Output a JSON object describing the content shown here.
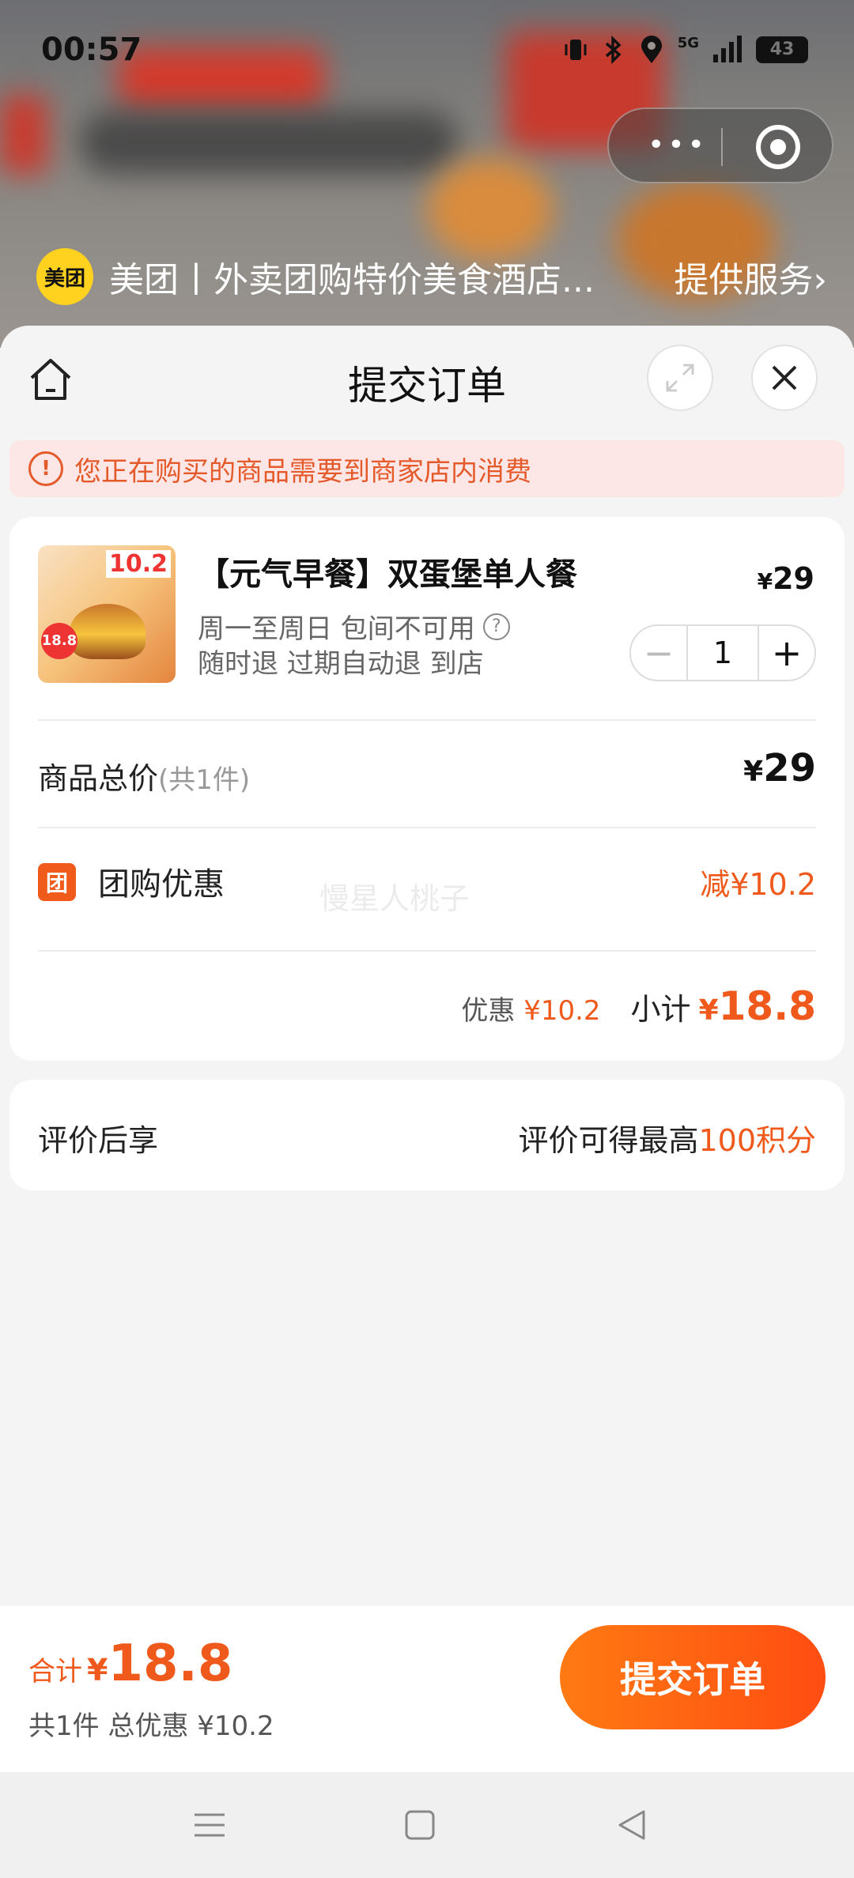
{
  "status_bar": {
    "time": "00:57",
    "network": "5G",
    "battery": "43"
  },
  "mini_program": {
    "logo_text": "美团",
    "title": "美团丨外卖团购特价美食酒店...",
    "service_label": "提供服务",
    "service_chevron": "›"
  },
  "sheet": {
    "title": "提交订单"
  },
  "notice": {
    "icon_glyph": "!",
    "text": "您正在购买的商品需要到商家店内消费"
  },
  "item": {
    "thumb_tag": "10.2",
    "thumb_badge": "18.8",
    "title": "【元气早餐】双蛋堡单人餐",
    "price_symbol": "¥",
    "price": "29",
    "rule1": "周一至周日 包间不可用",
    "rule2": "随时退 过期自动退 到店",
    "quantity": "1",
    "minus": "−",
    "plus": "+"
  },
  "summary": {
    "total_label": "商品总价",
    "total_sub": "(共1件)",
    "total_symbol": "¥",
    "total_value": "29",
    "group_icon": "团",
    "group_label": "团购优惠",
    "group_amount": "减¥10.2",
    "watermark": "慢星人桃子",
    "discount_label": "优惠",
    "discount_value": "¥10.2",
    "subtotal_label": "小计",
    "subtotal_symbol": "¥",
    "subtotal_value": "18.8"
  },
  "evaluation": {
    "left": "评价后享",
    "right_prefix": "评价可得最高",
    "right_highlight": "100积分"
  },
  "bottom": {
    "sum_label": "合计",
    "sum_symbol": "¥",
    "sum_value": "18.8",
    "detail": "共1件 总优惠 ¥10.2",
    "submit_label": "提交订单"
  },
  "icons": {
    "home": "home-icon",
    "expand": "expand-icon",
    "close": "close-icon",
    "menu": "menu-icon",
    "square": "square-icon",
    "back": "back-triangle-icon"
  },
  "colors": {
    "accent": "#ef5a1c",
    "button_start": "#ff7a12",
    "button_end": "#ff4d12",
    "notice_bg": "#fde7e6"
  }
}
